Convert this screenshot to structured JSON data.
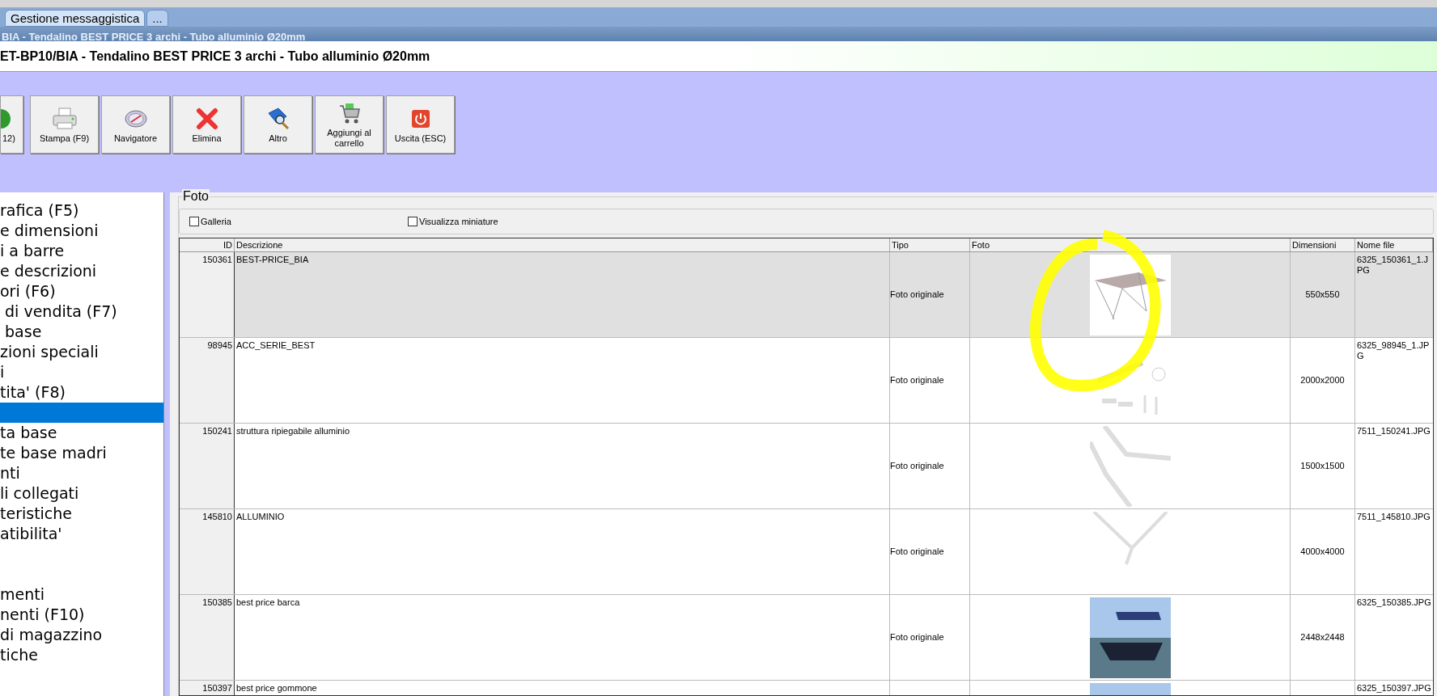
{
  "tabs": [
    {
      "label": "Gestione messaggistica",
      "selected": true
    },
    {
      "label": "...",
      "selected": false
    }
  ],
  "title_bar": "BIA - Tendalino BEST PRICE 3 archi - Tubo alluminio Ø20mm",
  "header": "ET-BP10/BIA - Tendalino BEST PRICE 3 archi - Tubo alluminio Ø20mm",
  "toolbar": [
    {
      "label": "12)"
    },
    {
      "label": "Stampa (F9)"
    },
    {
      "label": "Navigatore"
    },
    {
      "label": "Elimina"
    },
    {
      "label": "Altro"
    },
    {
      "label": "Aggiungi al carrello"
    },
    {
      "label": "Uscita (ESC)"
    }
  ],
  "sidebar": {
    "items": [
      {
        "label": "rafica (F5)",
        "selected": false
      },
      {
        "label": "e dimensioni",
        "selected": false
      },
      {
        "label": "i a barre",
        "selected": false
      },
      {
        "label": "e descrizioni",
        "selected": false
      },
      {
        "label": "ori (F6)",
        "selected": false
      },
      {
        "label": " di vendita (F7)",
        "selected": false
      },
      {
        "label": " base",
        "selected": false
      },
      {
        "label": "zioni speciali",
        "selected": false
      },
      {
        "label": "i",
        "selected": false
      },
      {
        "label": "tita' (F8)",
        "selected": false
      },
      {
        "selected": true
      },
      {
        "label": "ta base",
        "selected": false
      },
      {
        "label": "te base madri",
        "selected": false
      },
      {
        "label": "nti",
        "selected": false
      },
      {
        "label": "li collegati",
        "selected": false
      },
      {
        "label": "teristiche",
        "selected": false
      },
      {
        "label": "atibilita'",
        "selected": false
      },
      {
        "selected": false
      },
      {
        "selected": false
      },
      {
        "label": "menti",
        "selected": false
      },
      {
        "label": "nenti (F10)",
        "selected": false
      },
      {
        "label": "di magazzino",
        "selected": false
      },
      {
        "label": "tiche",
        "selected": false
      }
    ]
  },
  "foto": {
    "title": "Foto",
    "options": [
      {
        "label": "Galleria",
        "checked": false
      },
      {
        "label": "Visualizza miniature",
        "checked": false
      }
    ],
    "table": {
      "columns": [
        "ID",
        "Descrizione",
        "Tipo",
        "Foto",
        "Dimensioni",
        "Nome file"
      ],
      "rows": [
        {
          "id": "150361",
          "descrizione": "BEST-PRICE_BIA",
          "tipo": "Foto originale",
          "dimensioni": "550x550",
          "nome_file": "6325_150361_1.JPG",
          "selected": true
        },
        {
          "id": "98945",
          "descrizione": "ACC_SERIE_BEST",
          "tipo": "Foto originale",
          "dimensioni": "2000x2000",
          "nome_file": "6325_98945_1.JPG",
          "selected": false
        },
        {
          "id": "150241",
          "descrizione": "struttura ripiegabile alluminio",
          "tipo": "Foto originale",
          "dimensioni": "1500x1500",
          "nome_file": "7511_150241.JPG",
          "selected": false
        },
        {
          "id": "145810",
          "descrizione": "ALLUMINIO",
          "tipo": "Foto originale",
          "dimensioni": "4000x4000",
          "nome_file": "7511_145810.JPG",
          "selected": false
        },
        {
          "id": "150385",
          "descrizione": "best price barca",
          "tipo": "Foto originale",
          "dimensioni": "2448x2448",
          "nome_file": "6325_150385.JPG",
          "selected": false
        },
        {
          "id": "150397",
          "descrizione": "best price gommone",
          "nome_file": "6325_150397.JPG",
          "selected": false
        }
      ]
    }
  }
}
